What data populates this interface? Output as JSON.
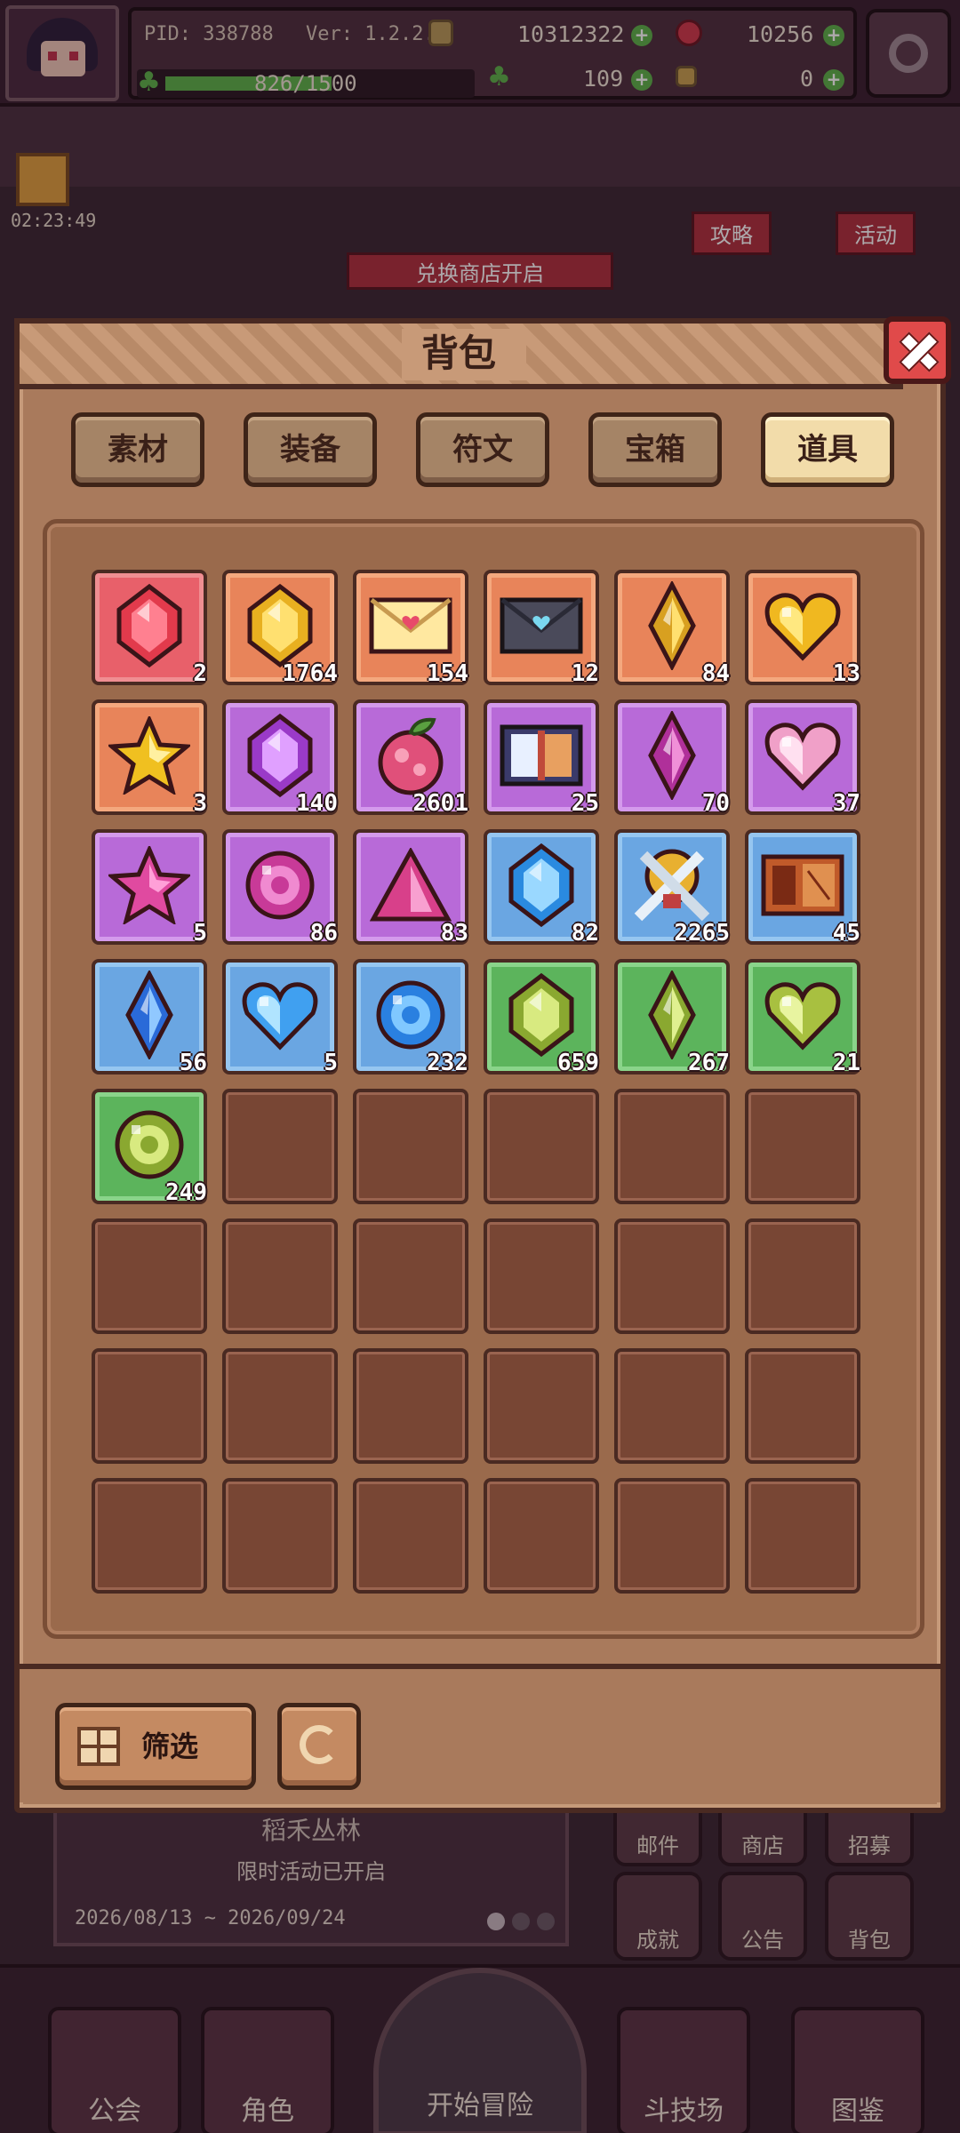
{
  "hud": {
    "pid": "PID: 338788",
    "version": "Ver: 1.2.2.4",
    "gold": "10312322",
    "gems": "10256",
    "exp": "826/1500",
    "exp_fraction": 0.55,
    "clover": "109",
    "keys": "0"
  },
  "background": {
    "timer": "02:23:49",
    "strategy_label": "攻略",
    "activity_label": "活动",
    "exchange_banner": "兑换商店开启",
    "event_title": "稻禾丛林",
    "event_subtitle": "限时活动已开启",
    "event_dates": "2026/08/13 ~ 2026/09/24",
    "side_buttons": [
      "邮件",
      "商店",
      "招募",
      "成就",
      "公告",
      "背包"
    ],
    "nav": [
      "公会",
      "角色",
      "开始冒险",
      "斗技场",
      "图鉴"
    ]
  },
  "window": {
    "title": "背包",
    "tabs": [
      "素材",
      "装备",
      "符文",
      "宝箱",
      "道具"
    ],
    "active_tab": "道具",
    "filter_label": "筛选"
  },
  "items": [
    {
      "icon": "red-gem-icon",
      "rarity": "red",
      "qty": "2"
    },
    {
      "icon": "gold-gem-icon",
      "rarity": "orange",
      "qty": "1764"
    },
    {
      "icon": "love-letter-icon",
      "rarity": "orange",
      "qty": "154"
    },
    {
      "icon": "dark-letter-icon",
      "rarity": "orange",
      "qty": "12"
    },
    {
      "icon": "gold-crystal-icon",
      "rarity": "orange",
      "qty": "84"
    },
    {
      "icon": "gold-heart-icon",
      "rarity": "orange",
      "qty": "13"
    },
    {
      "icon": "gold-star-icon",
      "rarity": "orange",
      "qty": "3"
    },
    {
      "icon": "purple-gem-icon",
      "rarity": "purple",
      "qty": "140"
    },
    {
      "icon": "pink-fruit-icon",
      "rarity": "purple",
      "qty": "2601"
    },
    {
      "icon": "book-icon",
      "rarity": "purple",
      "qty": "25"
    },
    {
      "icon": "purple-crystal-icon",
      "rarity": "purple",
      "qty": "70"
    },
    {
      "icon": "pink-heart-icon",
      "rarity": "purple",
      "qty": "37"
    },
    {
      "icon": "pink-star-icon",
      "rarity": "purple",
      "qty": "5"
    },
    {
      "icon": "pink-orb-icon",
      "rarity": "purple",
      "qty": "86"
    },
    {
      "icon": "pink-triangle-icon",
      "rarity": "purple",
      "qty": "83"
    },
    {
      "icon": "blue-gem-icon",
      "rarity": "blue",
      "qty": "82"
    },
    {
      "icon": "crossed-swords-icon",
      "rarity": "blue",
      "qty": "2265"
    },
    {
      "icon": "brown-book-icon",
      "rarity": "blue",
      "qty": "45"
    },
    {
      "icon": "blue-crystal-icon",
      "rarity": "blue",
      "qty": "56"
    },
    {
      "icon": "blue-heart-icon",
      "rarity": "blue",
      "qty": "5"
    },
    {
      "icon": "blue-orb-icon",
      "rarity": "blue",
      "qty": "232"
    },
    {
      "icon": "green-gem-icon",
      "rarity": "green",
      "qty": "659"
    },
    {
      "icon": "green-crystal-icon",
      "rarity": "green",
      "qty": "267"
    },
    {
      "icon": "green-heart-icon",
      "rarity": "green",
      "qty": "21"
    },
    {
      "icon": "green-orb-icon",
      "rarity": "green",
      "qty": "249"
    }
  ],
  "total_slots": 48,
  "colors": {
    "red": "#e8606a",
    "orange": "#e8845a",
    "purple": "#b86ad8",
    "blue": "#6aa6e2",
    "green": "#5cb45c"
  }
}
